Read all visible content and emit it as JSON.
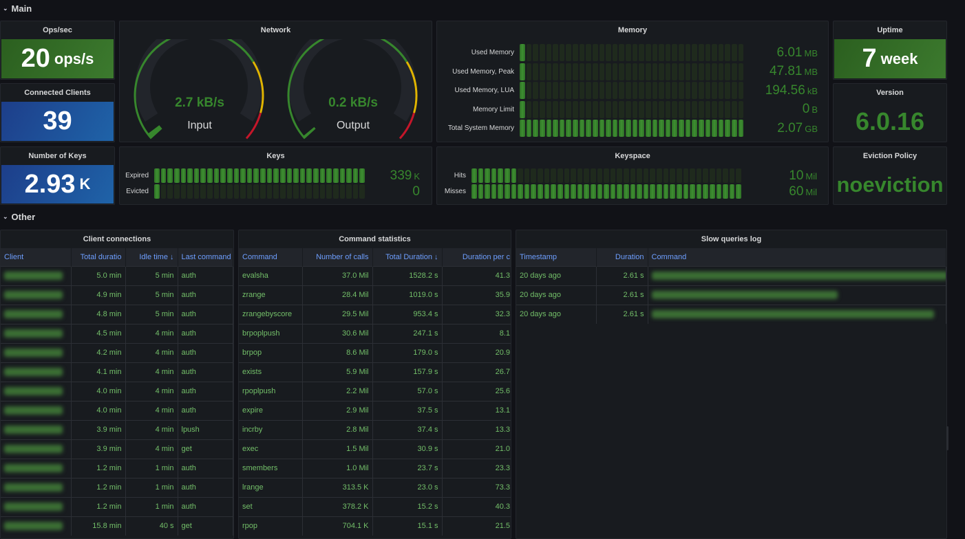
{
  "rows": {
    "main": "Main",
    "other": "Other"
  },
  "colors": {
    "green": "#37872d",
    "blue": "#1f60c4",
    "yellow": "#e0b400",
    "red": "#c4162a",
    "accent_text": "#6e9fff",
    "cell_text": "#73bf69"
  },
  "ops": {
    "title": "Ops/sec",
    "value": "20",
    "unit": "ops/s"
  },
  "clients": {
    "title": "Connected Clients",
    "value": "39"
  },
  "keys_count": {
    "title": "Number of Keys",
    "value": "2.93",
    "unit": "K"
  },
  "network": {
    "title": "Network",
    "input": {
      "value": "2.7 kB/s",
      "label": "Input",
      "fraction": 0.02
    },
    "output": {
      "value": "0.2 kB/s",
      "label": "Output",
      "fraction": 0.01
    }
  },
  "memory": {
    "title": "Memory",
    "rows": [
      {
        "label": "Used Memory",
        "value": "6.01",
        "unit": "MB",
        "fraction": 0.003
      },
      {
        "label": "Used Memory, Peak",
        "value": "47.81",
        "unit": "MB",
        "fraction": 0.023
      },
      {
        "label": "Used Memory, LUA",
        "value": "194.56",
        "unit": "kB",
        "fraction": 0.0001
      },
      {
        "label": "Memory Limit",
        "value": "0",
        "unit": "B",
        "fraction": 0
      },
      {
        "label": "Total System Memory",
        "value": "2.07",
        "unit": "GB",
        "fraction": 1.0
      }
    ]
  },
  "uptime": {
    "title": "Uptime",
    "value": "7",
    "unit": "week"
  },
  "version": {
    "title": "Version",
    "value": "6.0.16"
  },
  "eviction": {
    "title": "Eviction Policy",
    "value": "noeviction"
  },
  "keys": {
    "title": "Keys",
    "rows": [
      {
        "label": "Expired",
        "value": "339",
        "unit": "K",
        "fraction": 1.0
      },
      {
        "label": "Evicted",
        "value": "0",
        "unit": "",
        "fraction": 0
      }
    ]
  },
  "keyspace": {
    "title": "Keyspace",
    "rows": [
      {
        "label": "Hits",
        "value": "10",
        "unit": "Mil",
        "fraction": 0.17
      },
      {
        "label": "Misses",
        "value": "60",
        "unit": "Mil",
        "fraction": 1.0
      }
    ]
  },
  "client_connections": {
    "title": "Client connections",
    "columns": [
      "Client",
      "Total duratio",
      "Idle time ↓",
      "Last command"
    ],
    "rows": [
      [
        "",
        "5.0 min",
        "5 min",
        "auth"
      ],
      [
        "",
        "4.9 min",
        "5 min",
        "auth"
      ],
      [
        "",
        "4.8 min",
        "5 min",
        "auth"
      ],
      [
        "",
        "4.5 min",
        "4 min",
        "auth"
      ],
      [
        "",
        "4.2 min",
        "4 min",
        "auth"
      ],
      [
        "",
        "4.1 min",
        "4 min",
        "auth"
      ],
      [
        "",
        "4.0 min",
        "4 min",
        "auth"
      ],
      [
        "",
        "4.0 min",
        "4 min",
        "auth"
      ],
      [
        "",
        "3.9 min",
        "4 min",
        "lpush"
      ],
      [
        "",
        "3.9 min",
        "4 min",
        "get"
      ],
      [
        "",
        "1.2 min",
        "1 min",
        "auth"
      ],
      [
        "",
        "1.2 min",
        "1 min",
        "auth"
      ],
      [
        "",
        "1.2 min",
        "1 min",
        "auth"
      ],
      [
        "",
        "15.8 min",
        "40 s",
        "get"
      ]
    ]
  },
  "command_stats": {
    "title": "Command statistics",
    "columns": [
      "Command",
      "Number of calls",
      "Total Duration ↓",
      "Duration per c"
    ],
    "rows": [
      [
        "evalsha",
        "37.0 Mil",
        "1528.2 s",
        "41.3"
      ],
      [
        "zrange",
        "28.4 Mil",
        "1019.0 s",
        "35.9"
      ],
      [
        "zrangebyscore",
        "29.5 Mil",
        "953.4 s",
        "32.3"
      ],
      [
        "brpoplpush",
        "30.6 Mil",
        "247.1 s",
        "8.1"
      ],
      [
        "brpop",
        "8.6 Mil",
        "179.0 s",
        "20.9"
      ],
      [
        "exists",
        "5.9 Mil",
        "157.9 s",
        "26.7"
      ],
      [
        "rpoplpush",
        "2.2 Mil",
        "57.0 s",
        "25.6"
      ],
      [
        "expire",
        "2.9 Mil",
        "37.5 s",
        "13.1"
      ],
      [
        "incrby",
        "2.8 Mil",
        "37.4 s",
        "13.3"
      ],
      [
        "exec",
        "1.5 Mil",
        "30.9 s",
        "21.0"
      ],
      [
        "smembers",
        "1.0 Mil",
        "23.7 s",
        "23.3"
      ],
      [
        "lrange",
        "313.5 K",
        "23.0 s",
        "73.3"
      ],
      [
        "set",
        "378.2 K",
        "15.2 s",
        "40.3"
      ],
      [
        "rpop",
        "704.1 K",
        "15.1 s",
        "21.5"
      ]
    ]
  },
  "slow_log": {
    "title": "Slow queries log",
    "columns": [
      "Timestamp",
      "Duration",
      "Command"
    ],
    "rows": [
      [
        "20 days ago",
        "2.61 s",
        ""
      ],
      [
        "20 days ago",
        "2.61 s",
        ""
      ],
      [
        "20 days ago",
        "2.61 s",
        ""
      ]
    ]
  }
}
